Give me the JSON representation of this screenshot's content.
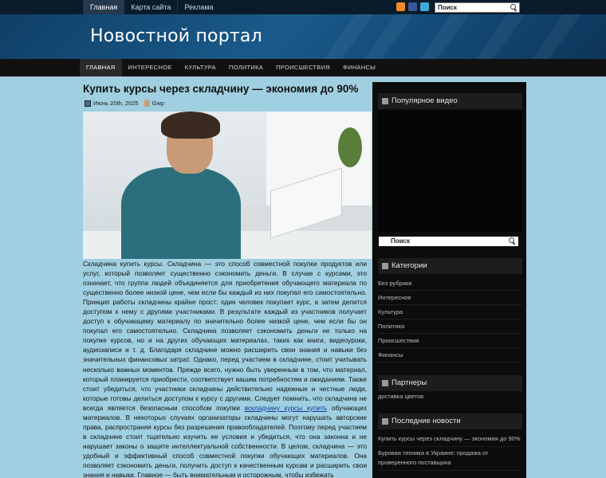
{
  "topnav": {
    "items": [
      {
        "label": "Главная"
      },
      {
        "label": "Карта сайта"
      },
      {
        "label": "Реклама"
      }
    ],
    "search_placeholder": "Поиск"
  },
  "social": [
    "rss-icon",
    "facebook-icon",
    "twitter-icon"
  ],
  "header": {
    "title": "Новостной портал"
  },
  "mainnav": {
    "items": [
      {
        "label": "ГЛАВНАЯ"
      },
      {
        "label": "ИНТЕРЕСНОЕ"
      },
      {
        "label": "КУЛЬТУРА"
      },
      {
        "label": "ПОЛИТИКА"
      },
      {
        "label": "ПРОИСШЕСТВИЯ"
      },
      {
        "label": "ФИНАНСЫ"
      }
    ]
  },
  "post": {
    "title": "Купить курсы через складчину — экономия до 90%",
    "date": "Июнь 20th, 2025",
    "author": "Gwp",
    "body_before_link": "Складчина купить курсы. Складчина — это способ совместной покупки продуктов или услуг, который позволяет существенно сэкономить деньги. В случае с курсами, это означает, что группа людей объединяется для приобретения обучающего материала по существенно более низкой цене, чем если бы каждый из них покупал его самостоятельно. Принцип работы складчины крайне прост: один человек покупает курс, а затем делится доступом к нему с другими участниками. В результате каждый из участников получает доступ к обучающему материалу по значительно более низкой цене, чем если бы он покупал его самостоятельно. Складчина позволяет сэкономить деньги не только на покупке курсов, но и на других обучающих материалах, таких как книги, видеоуроки, аудиозаписи и т. д. Благодаря складчине можно расширить свои знания и навыки без значительных финансовых затрат. Однако, перед участием в складчине, стоит учитывать несколько важных моментов. Прежде всего, нужно быть уверенным в том, что материал, который планируется приобрести, соответствует вашим потребностям и ожиданиям. Также стоит убедиться, что участники складчины действительно надежные и честные люди, которые готовы делиться доступом к курсу с другими. Следует помнить, что складчина не всегда является безопасным способом покупки ",
    "link_text": "вскладчину курсы купить",
    "body_after_link": " обучающих материалов. В некоторых случаях организаторы складчины могут нарушать авторские права, распространяя курсы без разрешения правообладателей. Поэтому перед участием в складчине стоит тщательно изучить ее условия и убедиться, что она законна и не нарушает законы о защите интеллектуальной собственности. В целом, складчина — это удобный и эффективный способ совместной покупки обучающих материалов. Она позволяет сэкономить деньги, получить доступ к качественным курсам и расширить свои знания и навыки. Главное — быть внимательным и осторожным, чтобы избежать"
  },
  "sidebar": {
    "video_title": "Популярное видео",
    "search_placeholder": "Поиск",
    "categories_title": "Категории",
    "categories": [
      "Без рубрики",
      "Интересное",
      "Культура",
      "Политика",
      "Происшествия",
      "Финансы"
    ],
    "partners_title": "Партнеры",
    "partner_link": "доставка цветов",
    "news_title": "Последние новости",
    "news": [
      "Купить курсы через складчину — экономия до 90%",
      "Буровая техника в Украине: продажа от проверенного поставщика"
    ]
  }
}
